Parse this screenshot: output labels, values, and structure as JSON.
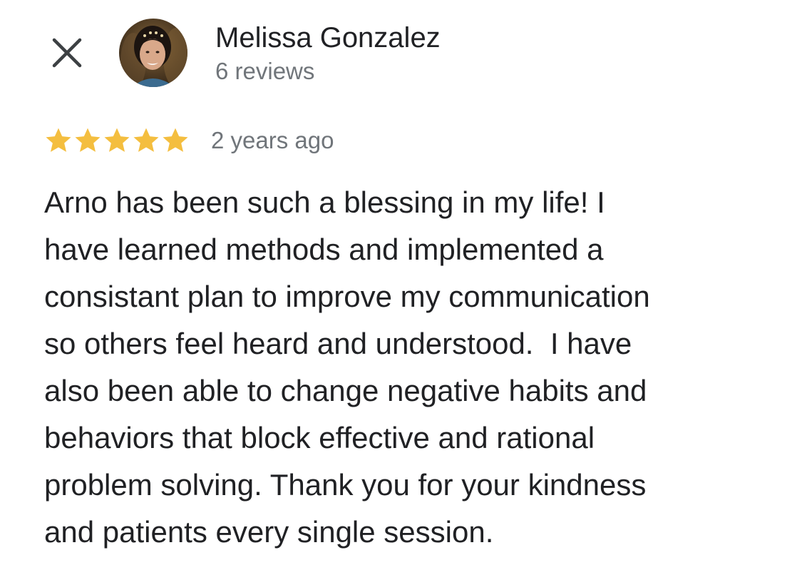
{
  "dialog": {
    "close_icon": "close-icon"
  },
  "reviewer": {
    "name": "Melissa Gonzalez",
    "review_count_text": "6 reviews",
    "avatar": "profile-photo"
  },
  "review": {
    "rating": 5,
    "rating_max": 5,
    "star_color": "#F4BE3F",
    "time_ago": "2 years ago",
    "text_lines": [
      "Arno has been such a blessing in my life! I",
      "have learned methods and implemented a",
      "consistant plan to improve my communication",
      "so others feel heard and understood.  I have",
      "also been able to change negative habits and",
      "behaviors that block effective and rational",
      "problem solving. Thank you for your kindness",
      "and patients every single session."
    ]
  }
}
